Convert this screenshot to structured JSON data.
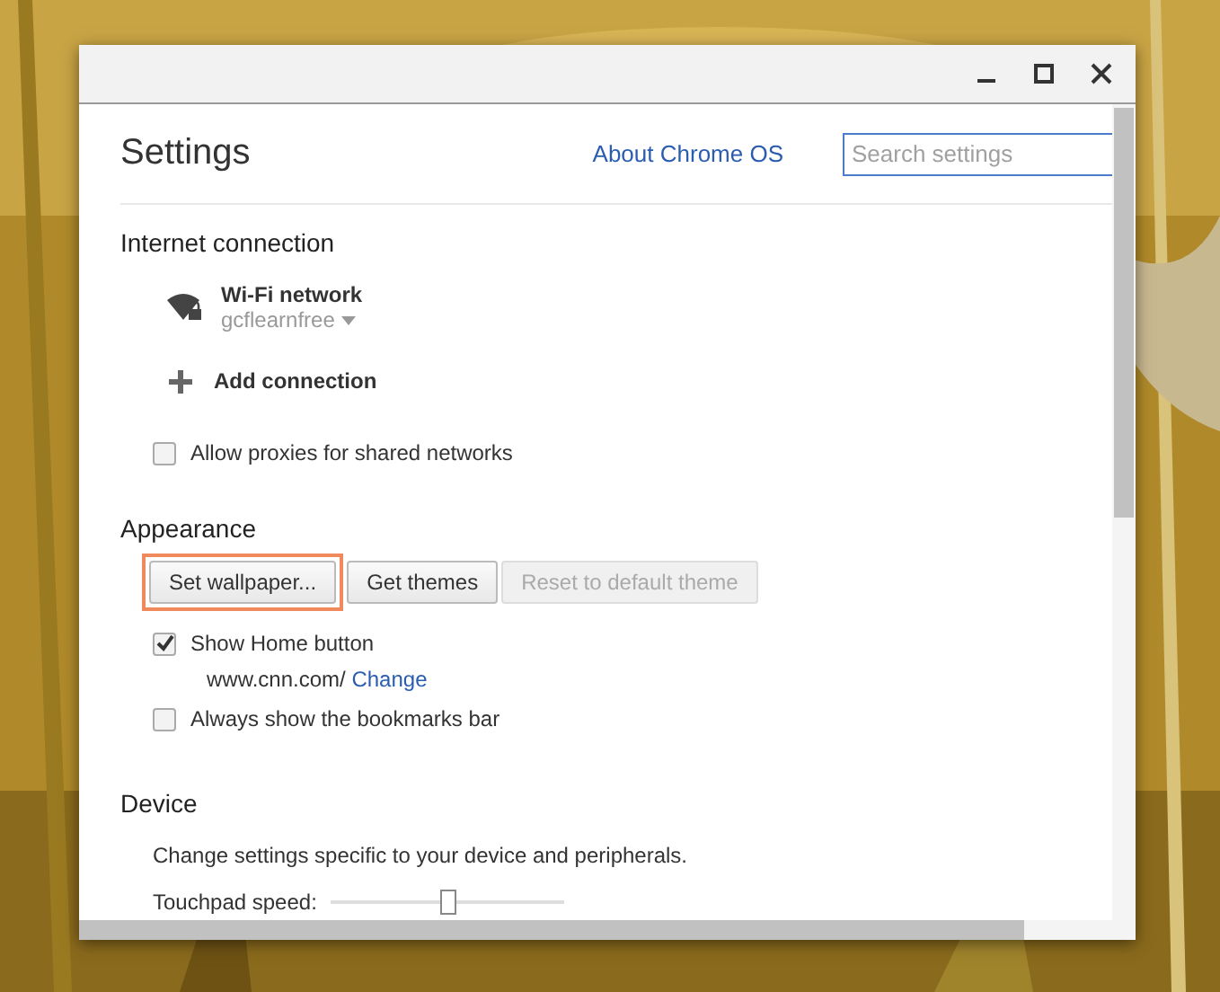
{
  "header": {
    "title": "Settings",
    "about_link": "About Chrome OS",
    "search": {
      "placeholder": "Search settings"
    }
  },
  "internet": {
    "heading": "Internet connection",
    "network": {
      "name": "Wi-Fi network",
      "ssid": "gcflearnfree"
    },
    "add_connection": "Add connection",
    "options": [
      {
        "label": "Allow proxies for shared networks",
        "checked": false
      }
    ]
  },
  "appearance": {
    "heading": "Appearance",
    "buttons": [
      {
        "label": "Set wallpaper...",
        "disabled": false,
        "highlighted": true
      },
      {
        "label": "Get themes",
        "disabled": false,
        "highlighted": false
      },
      {
        "label": "Reset to default theme",
        "disabled": true,
        "highlighted": false
      }
    ],
    "options": [
      {
        "label": "Show Home button",
        "checked": true,
        "home_url": "www.cnn.com/",
        "change_link": "Change"
      },
      {
        "label": "Always show the bookmarks bar",
        "checked": false
      }
    ]
  },
  "device": {
    "heading": "Device",
    "description": "Change settings specific to your device and peripherals.",
    "touchpad": {
      "label": "Touchpad speed:",
      "level": 0.5
    }
  }
}
